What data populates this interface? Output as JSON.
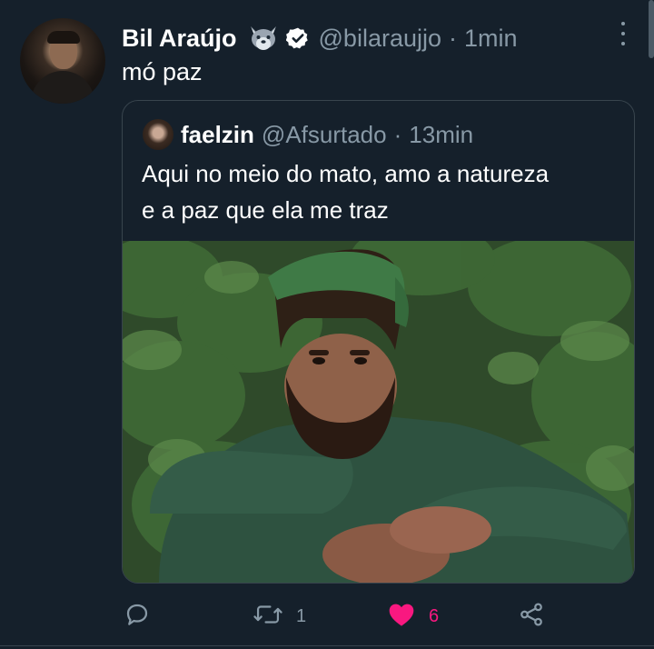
{
  "tweet": {
    "author": {
      "display_name": "Bil Araújo",
      "handle": "@bilaraujjo",
      "emoji": "wolf-emoji",
      "verified": true
    },
    "separator": "·",
    "time": "1min",
    "text": "mó paz",
    "more_icon": "more-vertical-icon"
  },
  "quoted": {
    "author": {
      "display_name": "faelzin",
      "handle": "@Afsurtado"
    },
    "separator": "·",
    "time": "13min",
    "text_line1": "Aqui no meio do mato, amo a natureza",
    "text_line2": "e a paz que ela me traz",
    "media": "photo-man-green-headband-in-jungle"
  },
  "actions": {
    "reply": {
      "icon": "reply-icon",
      "count": ""
    },
    "retweet": {
      "icon": "retweet-icon",
      "count": "1"
    },
    "like": {
      "icon": "heart-filled-icon",
      "count": "6",
      "color": "#f91880"
    },
    "share": {
      "icon": "share-icon"
    }
  },
  "colors": {
    "background": "#15202b",
    "secondary_text": "#8899a6",
    "border": "#38444d",
    "verified": "#ffffff",
    "like": "#f91880"
  }
}
